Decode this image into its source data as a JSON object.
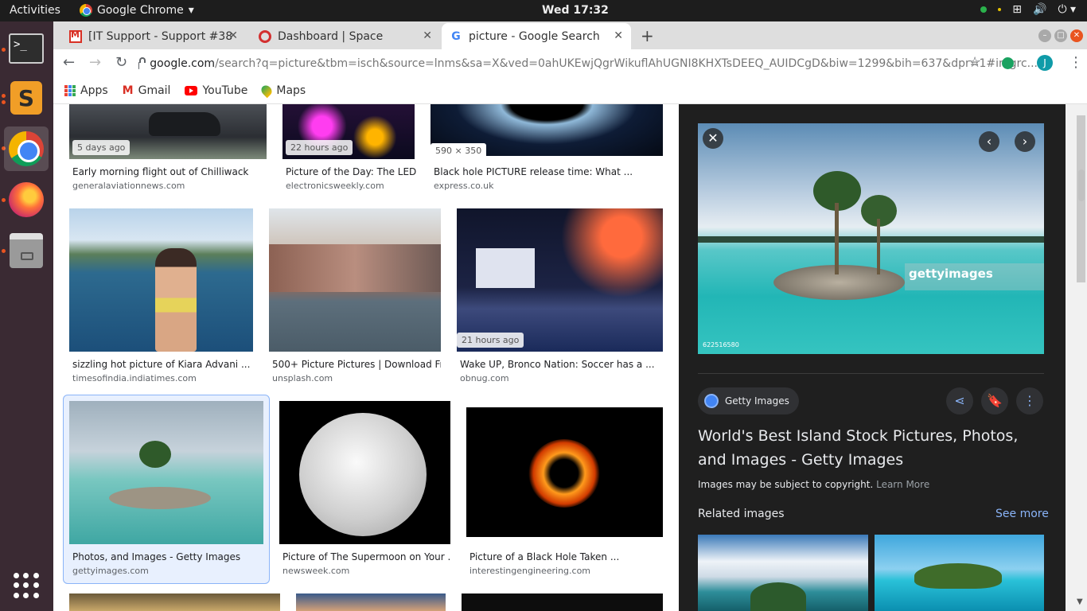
{
  "topbar": {
    "activities": "Activities",
    "app_name": "Google Chrome",
    "clock": "Wed 17:32"
  },
  "tabs": [
    {
      "label": "[IT Support - Support #38",
      "icon": "gmail-icon"
    },
    {
      "label": "Dashboard | Space",
      "icon": "opera-icon"
    },
    {
      "label": "picture - Google Search",
      "icon": "google-icon"
    }
  ],
  "omnibox": {
    "domain": "google.com",
    "path": "/search?q=picture&tbm=isch&source=lnms&sa=X&ved=0ahUKEwjQgrWikuflAhUGNI8KHXTsDEEQ_AUIDCgD&biw=1299&bih=637&dpr=1#imgrc..."
  },
  "profile_initial": "J",
  "bookmarks": [
    "Apps",
    "Gmail",
    "YouTube",
    "Maps"
  ],
  "results": [
    {
      "title": "Early morning flight out of Chilliwack",
      "source": "generalaviationnews.com",
      "badge": "5 days ago"
    },
    {
      "title": "Picture of the Day: The LED...",
      "source": "electronicsweekly.com",
      "badge": "22 hours ago"
    },
    {
      "title": "Black hole PICTURE release time: What ...",
      "source": "express.co.uk",
      "badge": "590 × 350"
    },
    {
      "title": "sizzling hot picture of Kiara Advani ...",
      "source": "timesofindia.indiatimes.com",
      "badge": ""
    },
    {
      "title": "500+ Picture Pictures | Download Fr...",
      "source": "unsplash.com",
      "badge": ""
    },
    {
      "title": "Wake UP, Bronco Nation: Soccer has a ...",
      "source": "obnug.com",
      "badge": "21 hours ago"
    },
    {
      "title": "Photos, and Images - Getty Images",
      "source": "gettyimages.com",
      "badge": ""
    },
    {
      "title": "Picture of The Supermoon on Your ...",
      "source": "newsweek.com",
      "badge": ""
    },
    {
      "title": "Picture of a Black Hole Taken ...",
      "source": "interestingengineering.com",
      "badge": ""
    }
  ],
  "panel": {
    "source_chip": "Getty Images",
    "title": "World's Best Island Stock Pictures, Photos, and Images - Getty Images",
    "copyright": "Images may be subject to copyright.",
    "learn_more": "Learn More",
    "related": "Related images",
    "see_more": "See more",
    "watermark": "gettyimages",
    "image_id": "622516580"
  }
}
